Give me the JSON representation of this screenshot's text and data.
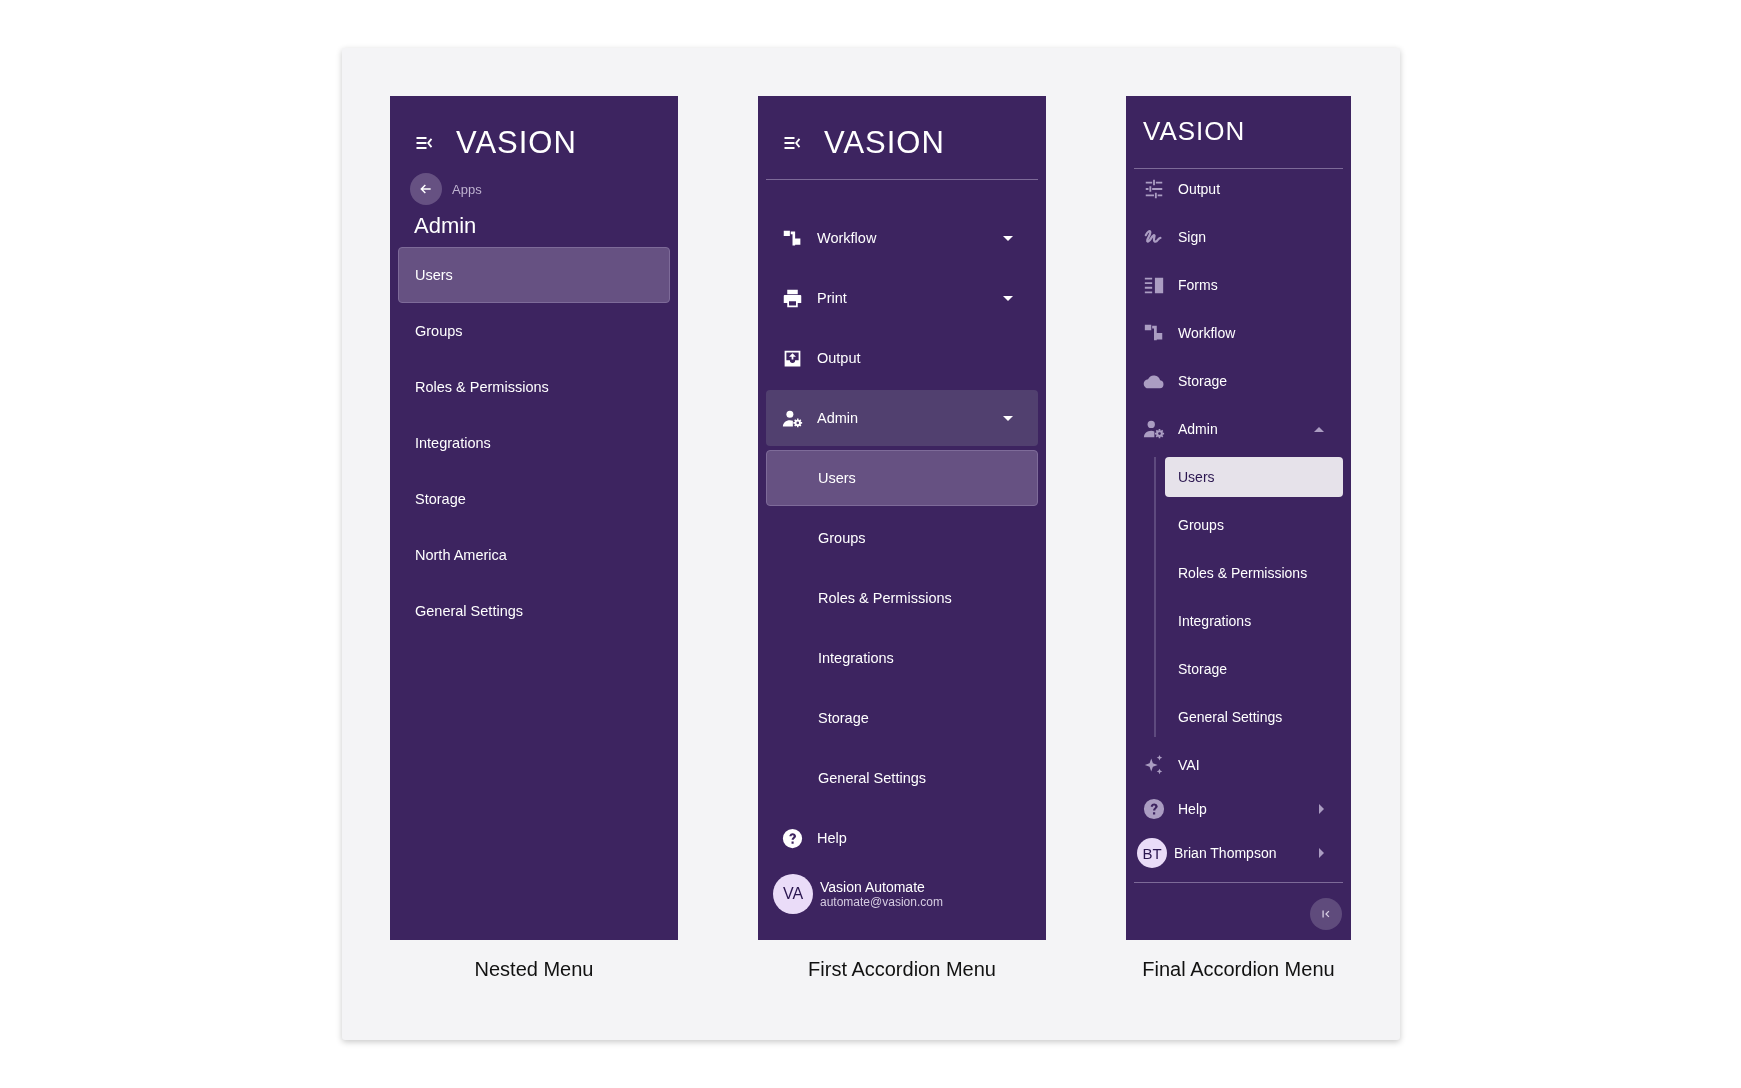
{
  "panels": [
    {
      "kind": "nested",
      "logo": "VASION",
      "back_label": "Apps",
      "title": "Admin",
      "items": [
        {
          "label": "Users",
          "selected": true
        },
        {
          "label": "Groups",
          "selected": false
        },
        {
          "label": "Roles & Permissions",
          "selected": false
        },
        {
          "label": "Integrations",
          "selected": false
        },
        {
          "label": "Storage",
          "selected": false
        },
        {
          "label": "North America",
          "selected": false
        },
        {
          "label": "General Settings",
          "selected": false
        }
      ],
      "caption": "Nested Menu"
    },
    {
      "kind": "accordion",
      "logo": "VASION",
      "items": [
        {
          "label": "Workflow",
          "expandable": true,
          "expanded": false
        },
        {
          "label": "Print",
          "expandable": true,
          "expanded": false
        },
        {
          "label": "Output",
          "expandable": false,
          "expanded": false
        },
        {
          "label": "Admin",
          "expandable": true,
          "expanded": true,
          "children": [
            {
              "label": "Users",
              "selected": true
            },
            {
              "label": "Groups",
              "selected": false
            },
            {
              "label": "Roles & Permissions",
              "selected": false
            },
            {
              "label": "Integrations",
              "selected": false
            },
            {
              "label": "Storage",
              "selected": false
            },
            {
              "label": "General Settings",
              "selected": false
            }
          ]
        }
      ],
      "help": {
        "label": "Help",
        "submenu": false
      },
      "user": {
        "initials": "VA",
        "name": "Vasion Automate",
        "email": "automate@vasion.com",
        "submenu": false
      },
      "caption": "First Accordion Menu"
    },
    {
      "kind": "final",
      "logo": "VASION",
      "items": [
        {
          "label": "Output",
          "expandable": false,
          "expanded": false
        },
        {
          "label": "Sign",
          "expandable": false,
          "expanded": false
        },
        {
          "label": "Forms",
          "expandable": false,
          "expanded": false
        },
        {
          "label": "Workflow",
          "expandable": false,
          "expanded": false
        },
        {
          "label": "Storage",
          "expandable": false,
          "expanded": false
        },
        {
          "label": "Admin",
          "expandable": true,
          "expanded": true,
          "children": [
            {
              "label": "Users",
              "selected": true
            },
            {
              "label": "Groups",
              "selected": false
            },
            {
              "label": "Roles & Permissions",
              "selected": false
            },
            {
              "label": "Integrations",
              "selected": false
            },
            {
              "label": "Storage",
              "selected": false
            },
            {
              "label": "General Settings",
              "selected": false
            }
          ]
        },
        {
          "label": "VAI",
          "expandable": false,
          "expanded": false
        }
      ],
      "help": {
        "label": "Help",
        "submenu": true
      },
      "user": {
        "initials": "BT",
        "name": "Brian Thompson",
        "submenu": true
      },
      "caption": "Final Accordion Menu"
    }
  ]
}
